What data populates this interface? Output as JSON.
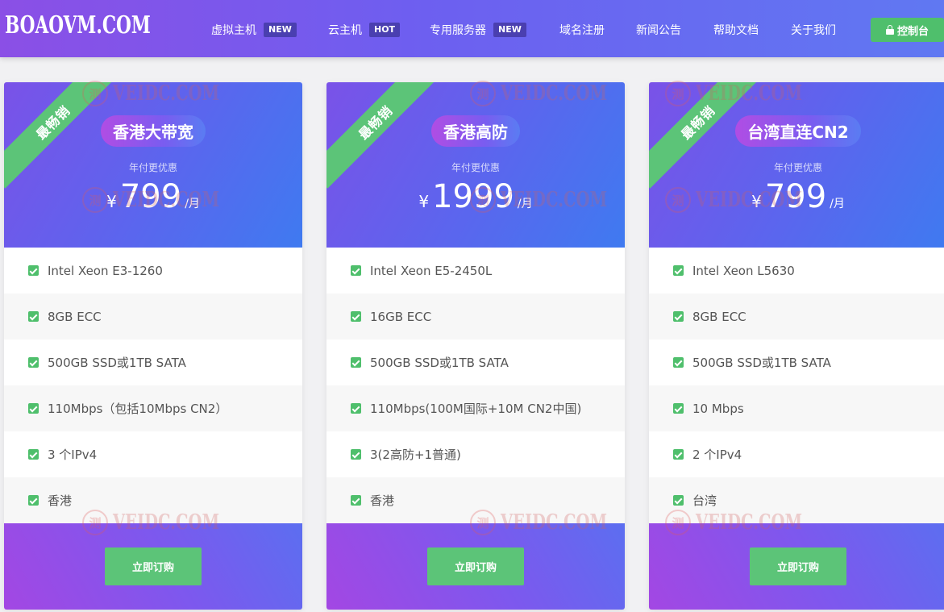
{
  "header": {
    "logo": "BOAOVM.COM",
    "nav": [
      {
        "label": "虚拟主机",
        "badge": "NEW"
      },
      {
        "label": "云主机",
        "badge": "HOT"
      },
      {
        "label": "专用服务器",
        "badge": "NEW"
      },
      {
        "label": "域名注册",
        "badge": ""
      },
      {
        "label": "新闻公告",
        "badge": ""
      },
      {
        "label": "帮助文档",
        "badge": ""
      },
      {
        "label": "关于我们",
        "badge": ""
      }
    ],
    "console_label": "控制台"
  },
  "plans": [
    {
      "ribbon": "最畅销",
      "title": "香港大带宽",
      "subtitle": "年付更优惠",
      "currency": "¥",
      "price": "799",
      "unit": "/月",
      "features": [
        "Intel Xeon E3-1260",
        "8GB ECC",
        "500GB SSD或1TB SATA",
        "110Mbps（包括10Mbps CN2）",
        "3 个IPv4",
        "香港"
      ],
      "button": "立即订购"
    },
    {
      "ribbon": "最畅销",
      "title": "香港高防",
      "subtitle": "年付更优惠",
      "currency": "¥",
      "price": "1999",
      "unit": "/月",
      "features": [
        "Intel Xeon E5-2450L",
        "16GB ECC",
        "500GB SSD或1TB SATA",
        "110Mbps(100M国际+10M CN2中国)",
        "3(2高防+1普通)",
        "香港"
      ],
      "button": "立即订购"
    },
    {
      "ribbon": "最畅销",
      "title": "台湾直连CN2",
      "subtitle": "年付更优惠",
      "currency": "¥",
      "price": "799",
      "unit": "/月",
      "features": [
        "Intel Xeon L5630",
        "8GB ECC",
        "500GB SSD或1TB SATA",
        "10 Mbps",
        "2 个IPv4",
        "台湾"
      ],
      "button": "立即订购"
    }
  ],
  "watermark": {
    "seal": "测",
    "text": "VEIDC.COM"
  },
  "colors": {
    "accent_green": "#4fbf6c",
    "header_start": "#8b4fe6",
    "header_end": "#6078f2",
    "badge_bg": "#4a3fb0"
  }
}
